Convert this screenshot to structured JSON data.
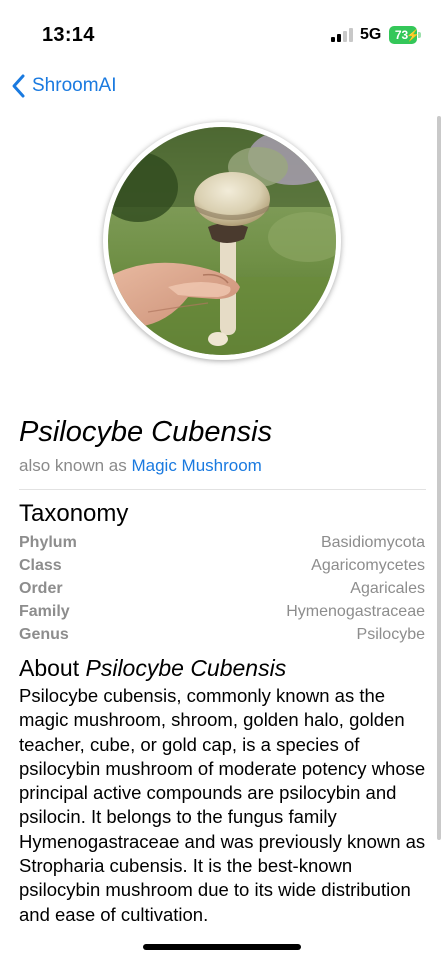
{
  "status_bar": {
    "time": "13:14",
    "network": "5G",
    "battery_level": "73",
    "signal_bars_active": 2,
    "signal_bars_total": 4
  },
  "nav": {
    "back_label": "ShroomAI",
    "back_icon": "chevron-left-icon"
  },
  "hero_image": {
    "subject": "hand holding a mushroom"
  },
  "species": {
    "name": "Psilocybe Cubensis",
    "also_known_prefix": "also known as",
    "common_name": "Magic Mushroom"
  },
  "taxonomy": {
    "heading": "Taxonomy",
    "rows": [
      {
        "key": "Phylum",
        "value": "Basidiomycota"
      },
      {
        "key": "Class",
        "value": "Agaricomycetes"
      },
      {
        "key": "Order",
        "value": "Agaricales"
      },
      {
        "key": "Family",
        "value": "Hymenogastraceae"
      },
      {
        "key": "Genus",
        "value": "Psilocybe"
      }
    ]
  },
  "about": {
    "heading_prefix": "About",
    "heading_name": "Psilocybe Cubensis",
    "text": "Psilocybe cubensis, commonly known as the magic mushroom, shroom, golden halo, golden teacher, cube, or gold cap, is a species of psilocybin mushroom of moderate potency whose principal active compounds are psilocybin and psilocin. It belongs to the fungus family Hymenogastraceae and was previously known as Stropharia cubensis.  It is the best-known psilocybin mushroom due to its wide distribution and ease of cultivation."
  },
  "colors": {
    "accent": "#1a7ae0",
    "battery": "#34c759",
    "secondary_text": "#8d8d8d"
  }
}
